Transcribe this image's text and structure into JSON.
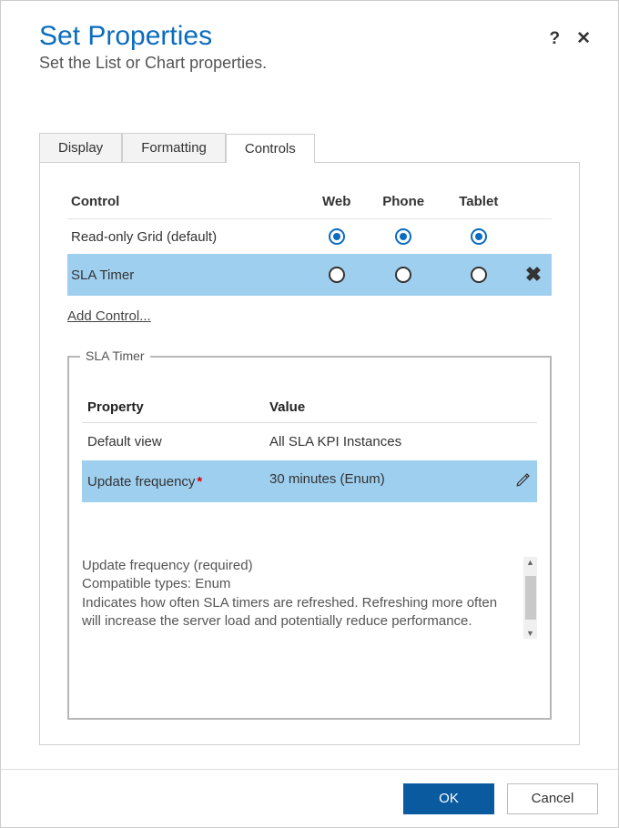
{
  "header": {
    "title": "Set Properties",
    "subtitle": "Set the List or Chart properties.",
    "help_symbol": "?",
    "close_symbol": "✕"
  },
  "tabs": {
    "display": "Display",
    "formatting": "Formatting",
    "controls": "Controls"
  },
  "controls_table": {
    "headers": {
      "control": "Control",
      "web": "Web",
      "phone": "Phone",
      "tablet": "Tablet"
    },
    "rows": [
      {
        "name": "Read-only Grid (default)",
        "web": "selected",
        "phone": "selected",
        "tablet": "selected",
        "deletable": false
      },
      {
        "name": "SLA Timer",
        "web": "unselected",
        "phone": "unselected",
        "tablet": "unselected",
        "deletable": true,
        "highlighted": true
      }
    ],
    "delete_symbol": "✖",
    "add_control": "Add Control..."
  },
  "property_group": {
    "legend": "SLA Timer",
    "headers": {
      "property": "Property",
      "value": "Value"
    },
    "rows": [
      {
        "property": "Default view",
        "value": "All SLA KPI Instances",
        "required": false,
        "selected": false
      },
      {
        "property": "Update frequency",
        "value": "30 minutes (Enum)",
        "required": true,
        "selected": true,
        "editable": true
      }
    ],
    "description": {
      "line1": "Update frequency (required)",
      "line2": "Compatible types: Enum",
      "line3": "Indicates how often SLA timers are refreshed. Refreshing more often will increase the server load and potentially reduce performance."
    },
    "scroll": {
      "up": "▲",
      "down": "▼"
    }
  },
  "footer": {
    "ok": "OK",
    "cancel": "Cancel"
  }
}
